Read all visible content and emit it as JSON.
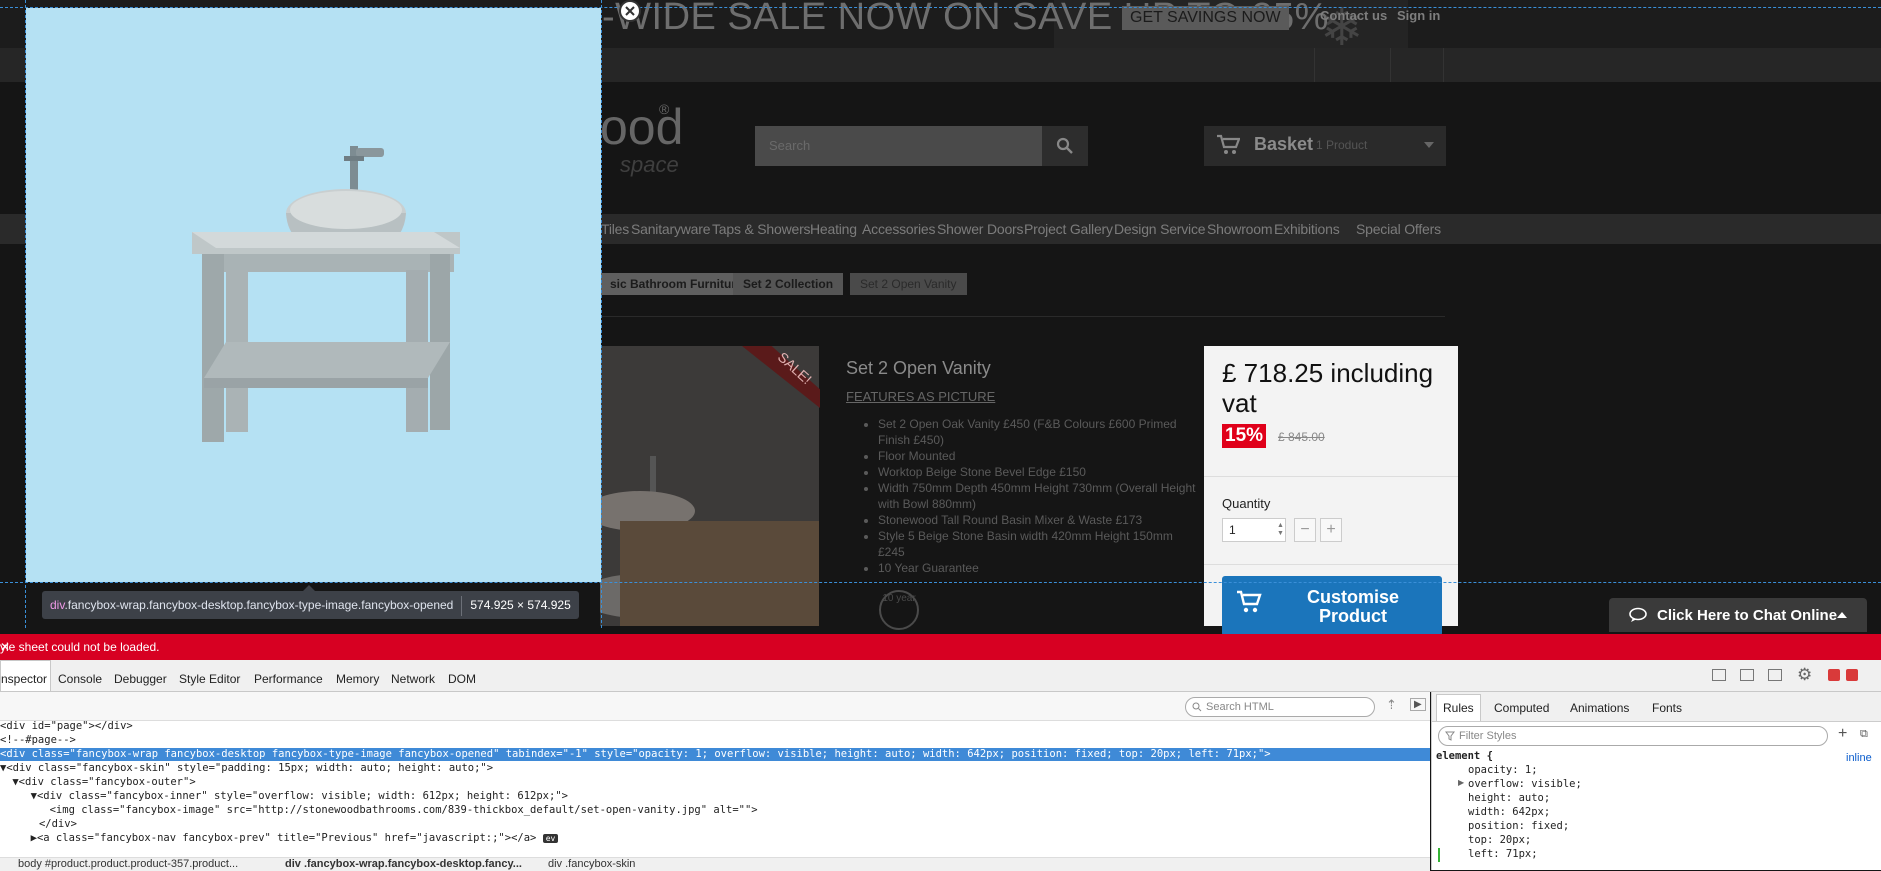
{
  "page": {
    "promo": {
      "text": "-WIDE SALE NOW ON SAVE UP TO 25%",
      "button": "GET SAVINGS NOW"
    },
    "top_links": [
      "Contact us",
      "Sign in"
    ],
    "logo": {
      "text": "ood",
      "reg": "®",
      "sub": "space"
    },
    "search_placeholder": "Search",
    "basket": {
      "label": "Basket",
      "count": "1 Product"
    },
    "nav": [
      "Tiles",
      "Sanitaryware",
      "Taps & Showers",
      "Heating",
      "Accessories",
      "Shower Doors",
      "Project Gallery",
      "Design Service",
      "Showroom",
      "Exhibitions",
      "Special Offers"
    ],
    "breadcrumbs": [
      "sic Bathroom Furniture",
      "Set 2 Collection",
      "Set 2 Open Vanity"
    ],
    "product": {
      "title": "Set 2 Open Vanity",
      "features_link": "FEATURES AS PICTURE",
      "sale_label": "SALE!",
      "bullets": [
        "Set 2 Open Oak Vanity £450 (F&B Colours £600 Primed Finish £450)",
        "Floor Mounted",
        "Worktop Beige Stone Bevel Edge £150",
        "Width 750mm Depth 450mm Height 730mm (Overall Height with Bowl 880mm)",
        "Stonewood Tall Round Basin Mixer & Waste £173",
        "Style 5 Beige Stone Basin width 420mm Height 150mm £245",
        "10 Year Guarantee"
      ],
      "guarantee_icon": "10 year",
      "price": "£ 718.25 including vat",
      "discount": "15%",
      "old_price": "£ 845.00",
      "quantity_label": "Quantity",
      "quantity_value": "1",
      "customise_label": "Customise Product"
    },
    "chat_label": "Click Here to Chat Online"
  },
  "overlay": {
    "selector_tag": "div",
    "selector_classes": ".fancybox-wrap.fancybox-desktop.fancybox-type-image.fancybox-opened",
    "dimensions": "574.925 × 574.925"
  },
  "devtools": {
    "error_message": "yle sheet could not be loaded.",
    "tabs": [
      "nspector",
      "Console",
      "Debugger",
      "Style Editor",
      "Performance",
      "Memory",
      "Network",
      "DOM"
    ],
    "active_tab": "nspector",
    "search_html_placeholder": "Search HTML",
    "html_lines": [
      "<div id=\"page\"></div>",
      "<!--#page-->",
      "<div class=\"fancybox-wrap fancybox-desktop fancybox-type-image fancybox-opened\" tabindex=\"-1\" style=\"opacity: 1; overflow: visible; height: auto; width: 642px; position: fixed; top: 20px; left: 71px;\">",
      "▼<div class=\"fancybox-skin\" style=\"padding: 15px; width: auto; height: auto;\">",
      " ▼<div class=\"fancybox-outer\">",
      "  ▼<div class=\"fancybox-inner\" style=\"overflow: visible; width: 612px; height: 612px;\">",
      "     <img class=\"fancybox-image\" src=\"http://stonewoodbathrooms.com/839-thickbox_default/set-open-vanity.jpg\" alt=\"\">",
      "   </div>",
      "  ▶<a class=\"fancybox-nav fancybox-prev\" title=\"Previous\" href=\"javascript:;\"></a>"
    ],
    "ev_badge": "ev",
    "breadcrumbs": [
      "body #product.product.product-357.product...",
      "div .fancybox-wrap.fancybox-desktop.fancy...",
      "div .fancybox-skin"
    ],
    "rules_tabs": [
      "Rules",
      "Computed",
      "Animations",
      "Fonts"
    ],
    "active_rules_tab": "Rules",
    "filter_placeholder": "Filter Styles",
    "rule_selector": "element {",
    "rule_source": "inline",
    "rule_props": [
      "opacity: 1;",
      "overflow: visible;",
      "height: auto;",
      "width: 642px;",
      "position: fixed;",
      "top: 20px;",
      "left: 71px;"
    ]
  }
}
